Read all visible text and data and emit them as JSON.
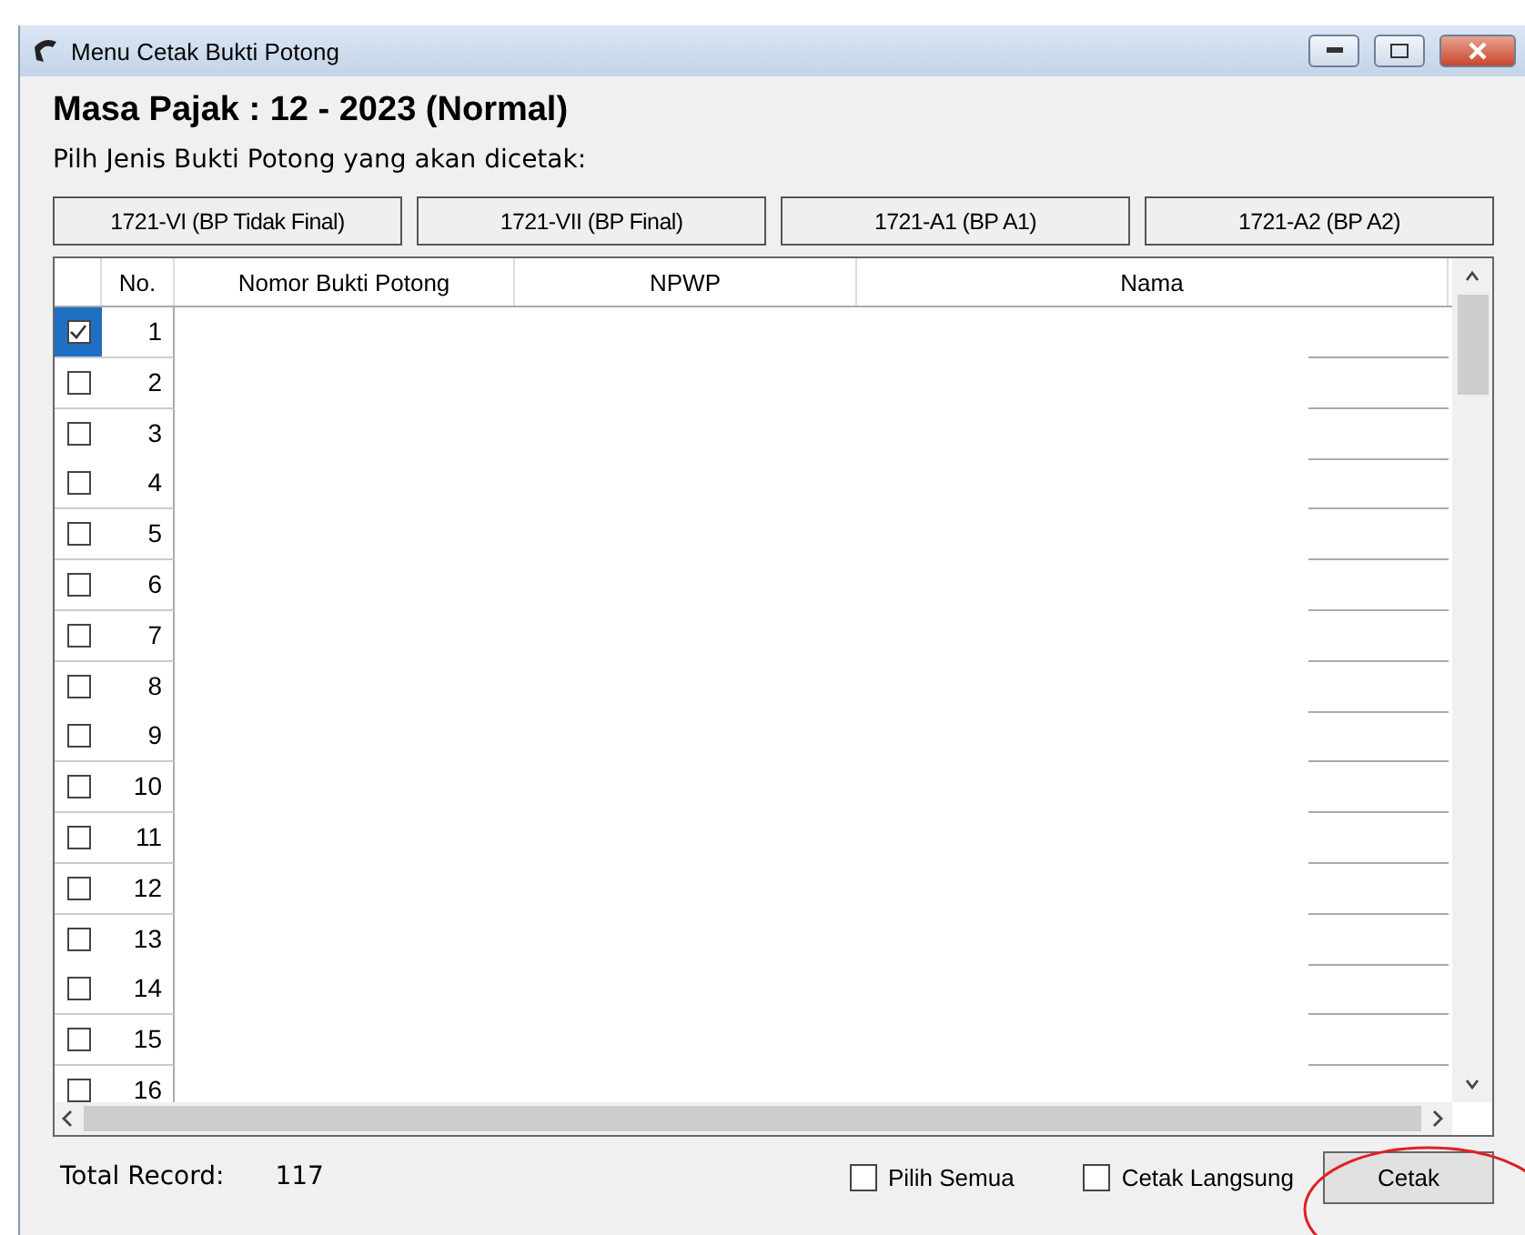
{
  "window": {
    "title": "Menu Cetak Bukti Potong"
  },
  "heading": "Masa Pajak :  12 - 2023 (Normal)",
  "prompt": "Pilh Jenis Bukti Potong yang akan dicetak:",
  "type_buttons": [
    "1721-VI (BP Tidak Final)",
    "1721-VII (BP Final)",
    "1721-A1 (BP A1)",
    "1721-A2 (BP A2)"
  ],
  "table": {
    "columns": [
      "No.",
      "Nomor Bukti Potong",
      "NPWP",
      "Nama"
    ],
    "rows": [
      {
        "no": "1",
        "checked": true
      },
      {
        "no": "2",
        "checked": false
      },
      {
        "no": "3",
        "checked": false
      },
      {
        "no": "4",
        "checked": false
      },
      {
        "no": "5",
        "checked": false
      },
      {
        "no": "6",
        "checked": false
      },
      {
        "no": "7",
        "checked": false
      },
      {
        "no": "8",
        "checked": false
      },
      {
        "no": "9",
        "checked": false
      },
      {
        "no": "10",
        "checked": false
      },
      {
        "no": "11",
        "checked": false
      },
      {
        "no": "12",
        "checked": false
      },
      {
        "no": "13",
        "checked": false
      },
      {
        "no": "14",
        "checked": false
      },
      {
        "no": "15",
        "checked": false
      },
      {
        "no": "16",
        "checked": false
      }
    ]
  },
  "footer": {
    "total_label": "Total Record:",
    "total_value": "117",
    "options": [
      {
        "label": "Pilih Semua",
        "checked": false
      },
      {
        "label": "Cetak Langsung",
        "checked": false
      }
    ],
    "print_button": "Cetak"
  }
}
